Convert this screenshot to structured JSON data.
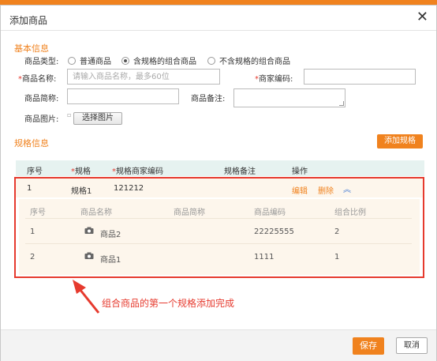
{
  "dialog": {
    "title": "添加商品",
    "close": "✕"
  },
  "basic": {
    "section_title": "基本信息",
    "type_label": "商品类型:",
    "type_options": [
      "普通商品",
      "含规格的组合商品",
      "不含规格的组合商品"
    ],
    "type_selected_index": 1,
    "name_label": "商品名称:",
    "name_placeholder": "请输入商品名称，最多60位",
    "merchant_code_label": "商家编码:",
    "short_name_label": "商品简称:",
    "remark_label": "商品备注:",
    "image_label": "商品图片:",
    "choose_image": "选择图片",
    "required_mark": "*"
  },
  "spec": {
    "section_title": "规格信息",
    "add_button": "添加规格",
    "headers": [
      "序号",
      "规格",
      "规格商家编码",
      "规格备注",
      "操作"
    ],
    "row": {
      "index": "1",
      "spec": "规格1",
      "code": "121212",
      "edit": "编辑",
      "delete": "删除",
      "collapse": "︽"
    },
    "sub_headers": [
      "序号",
      "商品名称",
      "商品简称",
      "商品编码",
      "组合比例"
    ],
    "sub_rows": [
      {
        "index": "1",
        "name": "商品2",
        "short": "",
        "code": "22225555",
        "ratio": "2"
      },
      {
        "index": "2",
        "name": "商品1",
        "short": "",
        "code": "1111",
        "ratio": "1"
      }
    ]
  },
  "annotation": {
    "text": "组合商品的第一个规格添加完成",
    "color": "#e63a2e"
  },
  "footer": {
    "save": "保存",
    "cancel": "取消"
  },
  "colors": {
    "accent": "#f0821e",
    "highlight": "#e63a2e"
  }
}
